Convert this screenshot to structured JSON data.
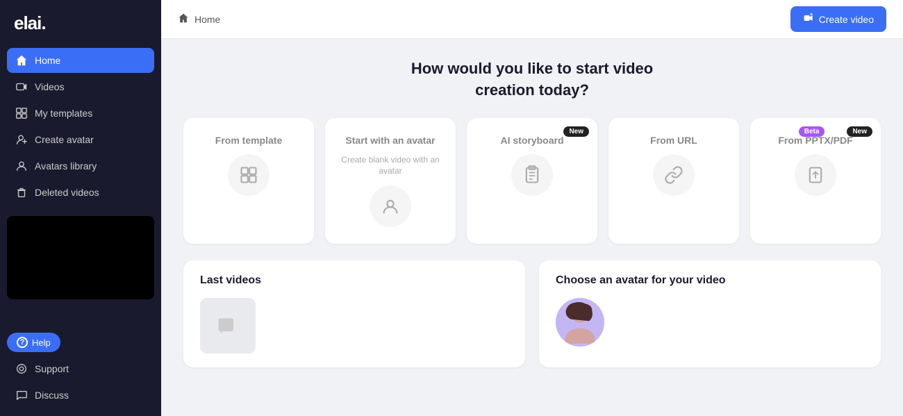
{
  "sidebar": {
    "logo": "elai.",
    "nav_items": [
      {
        "id": "home",
        "label": "Home",
        "icon": "home",
        "active": true
      },
      {
        "id": "videos",
        "label": "Videos",
        "icon": "video",
        "active": false
      },
      {
        "id": "my-templates",
        "label": "My templates",
        "icon": "templates",
        "active": false
      },
      {
        "id": "create-avatar",
        "label": "Create avatar",
        "icon": "person-plus",
        "active": false
      },
      {
        "id": "avatars-library",
        "label": "Avatars library",
        "icon": "person",
        "active": false
      },
      {
        "id": "deleted-videos",
        "label": "Deleted videos",
        "icon": "trash",
        "active": false
      }
    ],
    "bottom_items": [
      {
        "id": "support",
        "label": "Support",
        "icon": "support"
      },
      {
        "id": "discuss",
        "label": "Discuss",
        "icon": "discuss"
      }
    ],
    "help_label": "Help"
  },
  "header": {
    "breadcrumb_icon": "home",
    "breadcrumb_label": "Home",
    "create_video_label": "Create video",
    "create_video_icon": "plus-video"
  },
  "creation": {
    "title": "How would you like to start video\ncreation today?",
    "cards": [
      {
        "id": "from-template",
        "title": "From template",
        "subtitle": "",
        "icon": "grid",
        "badge": null
      },
      {
        "id": "start-with-avatar",
        "title": "Start with an avatar",
        "subtitle": "Create blank video with an avatar",
        "icon": "person-circle",
        "badge": null
      },
      {
        "id": "ai-storyboard",
        "title": "AI storyboard",
        "subtitle": "",
        "icon": "clipboard",
        "badge": "New"
      },
      {
        "id": "from-url",
        "title": "From URL",
        "subtitle": "",
        "icon": "link",
        "badge": null
      },
      {
        "id": "from-pptx",
        "title": "From PPTX/PDF",
        "subtitle": "",
        "icon": "upload",
        "badge_beta": "Beta",
        "badge_new": "New"
      }
    ]
  },
  "last_videos": {
    "title": "Last videos"
  },
  "choose_avatar": {
    "title": "Choose an avatar for your video"
  }
}
